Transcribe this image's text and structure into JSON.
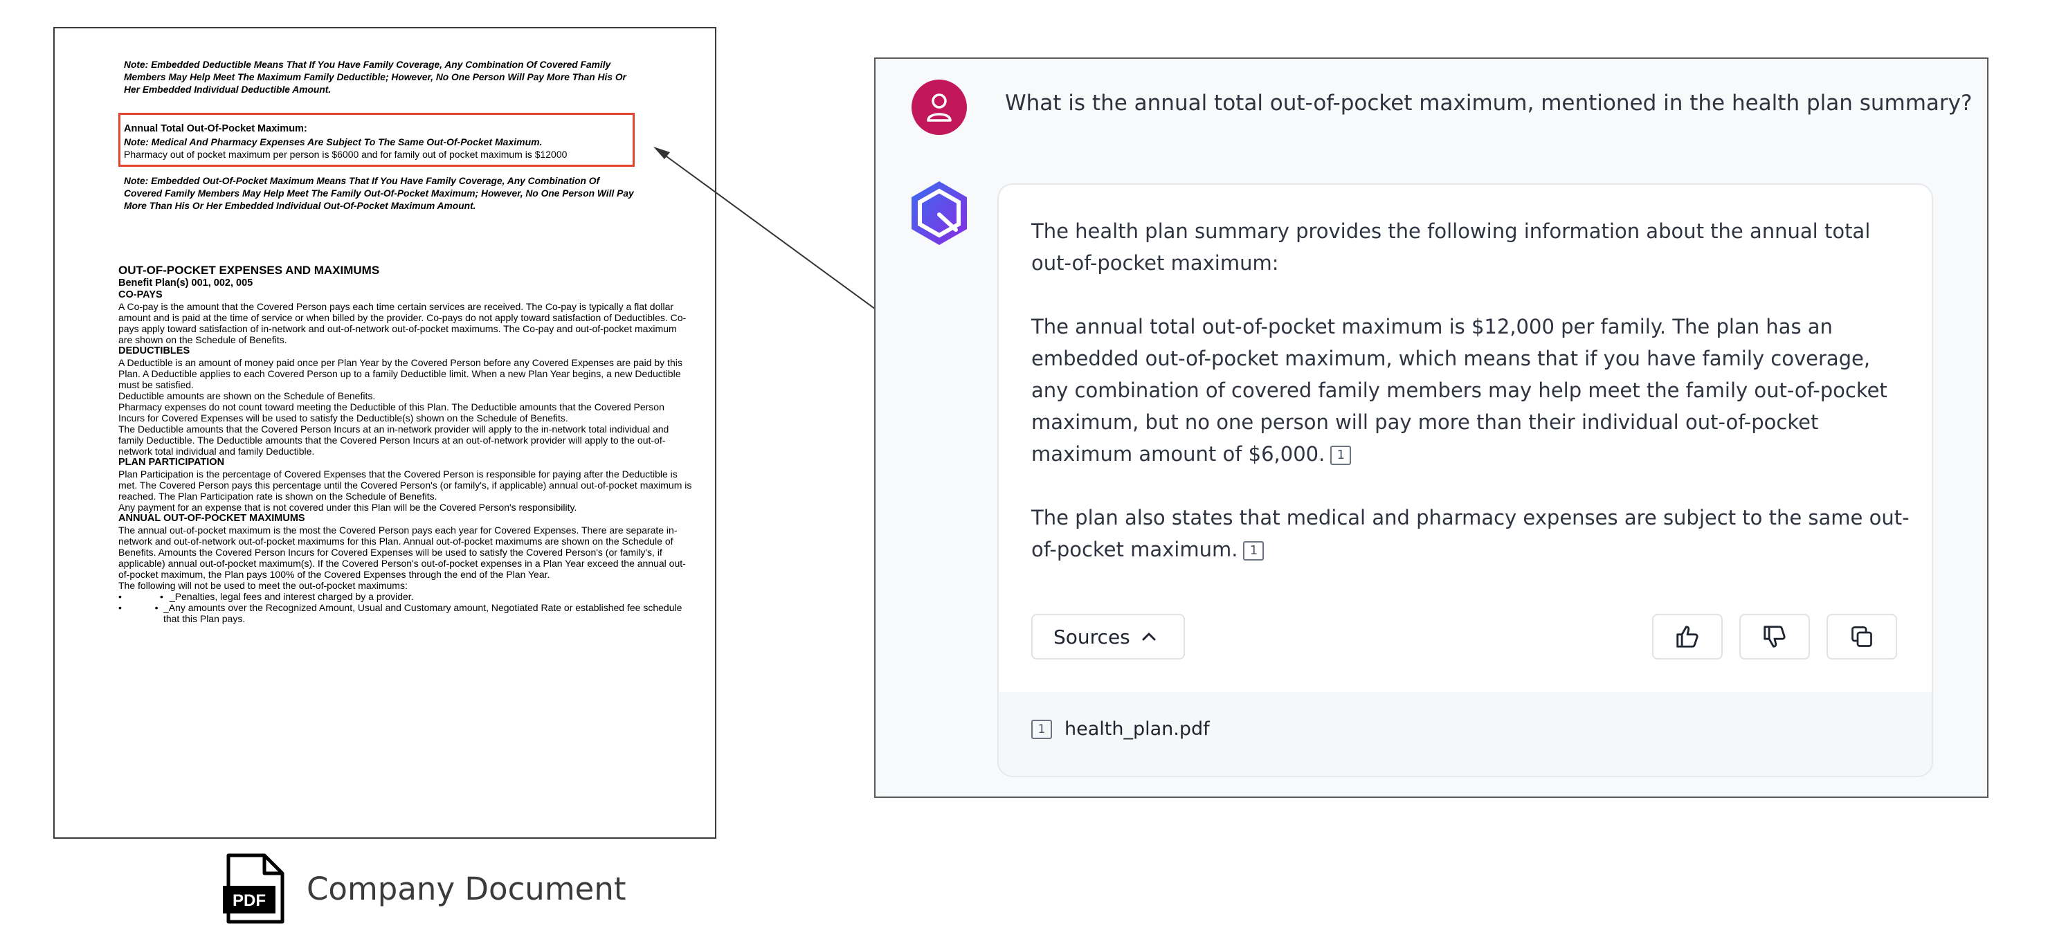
{
  "document": {
    "note1": "Note: Embedded Deductible Means That If You Have Family Coverage, Any Combination Of Covered Family Members May Help Meet The Maximum Family Deductible; However, No One Person Will Pay More Than His Or Her Embedded Individual Deductible Amount.",
    "highlight_title": "Annual Total Out-Of-Pocket Maximum:",
    "highlight_note": "Note: Medical And Pharmacy Expenses Are Subject To The Same Out-Of-Pocket Maximum.",
    "highlight_line": "Pharmacy out of pocket maximum per person is $6000 and for family out of pocket maximum is $12000",
    "note2": "Note: Embedded Out-Of-Pocket Maximum Means That If You Have Family Coverage, Any Combination Of Covered Family Members May Help Meet The Family Out-Of-Pocket Maximum; However, No One Person Will Pay More Than His Or Her Embedded Individual Out-Of-Pocket Maximum Amount.",
    "section_title": "OUT-OF-POCKET EXPENSES AND MAXIMUMS",
    "benefit_plans": "Benefit Plan(s) 001, 002, 005",
    "copays_heading": "CO-PAYS",
    "copays_text": "A Co-pay is the amount that the Covered Person pays each time certain services are received. The Co-pay is typically a flat dollar amount and is paid at the time of service or when billed by the provider. Co-pays do not apply toward satisfaction of Deductibles. Co-pays apply toward satisfaction of in-network and out-of-network out-of-pocket maximums. The Co-pay and out-of-pocket maximum are shown on the Schedule of Benefits.",
    "deductibles_heading": "DEDUCTIBLES",
    "deductibles_text1": "A Deductible is an amount of money paid once per Plan Year by the Covered Person before any Covered Expenses are paid by this Plan. A Deductible applies to each Covered Person up to a family Deductible limit. When a new Plan Year begins, a new Deductible must be satisfied.",
    "deductibles_text2": "Deductible amounts are shown on the Schedule of Benefits.",
    "deductibles_text3": "Pharmacy expenses do not count toward meeting the Deductible of this Plan. The Deductible amounts that the Covered Person Incurs for Covered Expenses will be used to satisfy the Deductible(s) shown on the Schedule of Benefits.",
    "deductibles_text4": "The Deductible amounts that the Covered Person Incurs at an in-network provider will apply to the in-network total individual and family Deductible. The Deductible amounts that the Covered Person Incurs at an out-of-network provider will apply to the out-of-network total individual and family Deductible.",
    "participation_heading": "PLAN PARTICIPATION",
    "participation_text1": "Plan Participation is the percentage of Covered Expenses that the Covered Person is responsible for paying after the Deductible is met. The Covered Person pays this percentage until the Covered Person's (or family's, if applicable) annual out-of-pocket maximum is reached. The Plan Participation rate is shown on the Schedule of Benefits.",
    "participation_text2": "Any payment for an expense that is not covered under this Plan will be the Covered Person's responsibility.",
    "annual_heading": "ANNUAL OUT-OF-POCKET MAXIMUMS",
    "annual_text": "The annual out-of-pocket maximum is the most the Covered Person pays each year for Covered Expenses. There are separate in-network and out-of-network out-of-pocket maximums for this Plan. Annual out-of-pocket maximums are shown on the Schedule of Benefits. Amounts the Covered Person Incurs for Covered Expenses will be used to satisfy the Covered Person's (or family's, if applicable) annual out-of-pocket maximum(s). If the Covered Person's out-of-pocket expenses in a Plan Year exceed the annual out-of-pocket maximum, the Plan pays 100% of the Covered Expenses through the end of the Plan Year.",
    "following_text": "The following will not be used to meet the out-of-pocket maximums:",
    "bullets": [
      "_Penalties, legal fees and interest charged by a provider.",
      "_Any amounts over the Recognized Amount, Usual and Customary amount, Negotiated Rate or established fee schedule that this Plan pays."
    ],
    "bullet_char": "•"
  },
  "pdf_label": "Company Document",
  "pdf_icon_text": "PDF",
  "chat": {
    "question": "What is the annual total out-of-pocket maximum, mentioned in the health plan summary?",
    "answer_p1": "The health plan summary provides the following information about the annual total out-of-pocket maximum:",
    "answer_p2": "The annual total out-of-pocket maximum is $12,000 per family. The plan has an embedded out-of-pocket maximum, which means that if you have family coverage, any combination of covered family members may help meet the family out-of-pocket maximum, but no one person will pay more than their individual out-of-pocket maximum amount of $6,000.",
    "answer_p3": "The plan also states that medical and pharmacy expenses are subject to the same out-of-pocket maximum.",
    "citation": "1",
    "sources_label": "Sources",
    "source_file": "health_plan.pdf",
    "icons": [
      "thumbs-up-icon",
      "thumbs-down-icon",
      "copy-icon",
      "user-icon",
      "assistant-logo-icon",
      "chevron-up-icon"
    ]
  },
  "colors": {
    "highlight_border": "#e4432f",
    "user_avatar": "#c2185b",
    "bot_gradient_start": "#3a6df0",
    "bot_gradient_end": "#8a2be2"
  }
}
